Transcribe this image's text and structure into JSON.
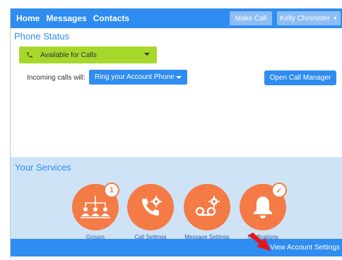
{
  "nav": {
    "home": "Home",
    "messages": "Messages",
    "contacts": "Contacts"
  },
  "header": {
    "make_call": "Make Call",
    "user_name": "Kelly Chronister"
  },
  "phone_status": {
    "title": "Phone Status",
    "availability": "Available for Calls",
    "incoming_label": "Incoming calls will:",
    "incoming_option": "Ring your Account Phone",
    "open_call_manager": "Open Call Manager"
  },
  "services": {
    "title": "Your Services",
    "items": [
      {
        "label": "Groups",
        "badge": "1",
        "icon": "groups-icon"
      },
      {
        "label": "Call Settings",
        "badge": "",
        "icon": "call-settings-icon"
      },
      {
        "label": "Message Settings",
        "badge": "",
        "icon": "message-settings-icon"
      },
      {
        "label": "Notifications",
        "badge": "✓",
        "icon": "notifications-icon"
      }
    ]
  },
  "footer": {
    "view_account_settings": "View Account Settings"
  },
  "colors": {
    "primary": "#2f8cf0",
    "available": "#a6d82c",
    "service_orange": "#f47b45",
    "services_bg": "#cfe3f7",
    "arrow": "#e8141c"
  }
}
